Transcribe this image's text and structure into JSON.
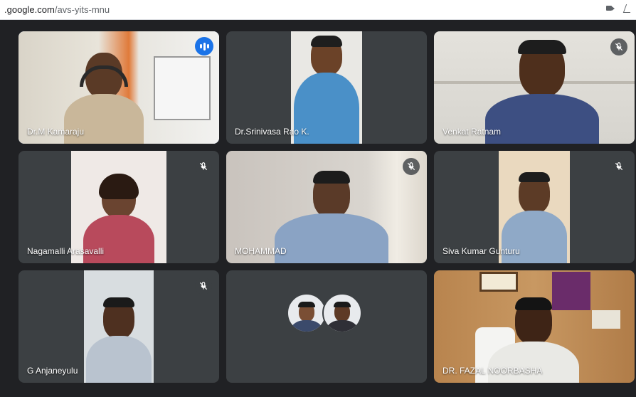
{
  "browser": {
    "url_domain": ".google.com",
    "url_path": "/avs-yits-mnu"
  },
  "participants": [
    {
      "name": "Dr.M Kamaraju",
      "speaking": true,
      "muted": false
    },
    {
      "name": "Dr.Srinivasa Rao K.",
      "speaking": false,
      "muted": false
    },
    {
      "name": "Venkat Ratnam",
      "speaking": false,
      "muted": true
    },
    {
      "name": "Nagamalli Arasavalli",
      "speaking": false,
      "muted": true
    },
    {
      "name": "MOHAMMAD",
      "speaking": false,
      "muted": true
    },
    {
      "name": "Siva Kumar Gunturu",
      "speaking": false,
      "muted": true
    },
    {
      "name": "G Anjaneyulu",
      "speaking": false,
      "muted": true
    },
    {
      "name": "",
      "speaking": false,
      "muted": false
    },
    {
      "name": "DR. FAZAL NOORBASHA",
      "speaking": false,
      "muted": false
    }
  ],
  "colors": {
    "background": "#202124",
    "tile": "#3c4043",
    "active_outline": "#8ab4f8",
    "speaking_badge": "#1a73e8"
  },
  "icons": [
    "camera-icon",
    "edit-icon",
    "mic-off-icon",
    "speaking-indicator-icon"
  ]
}
